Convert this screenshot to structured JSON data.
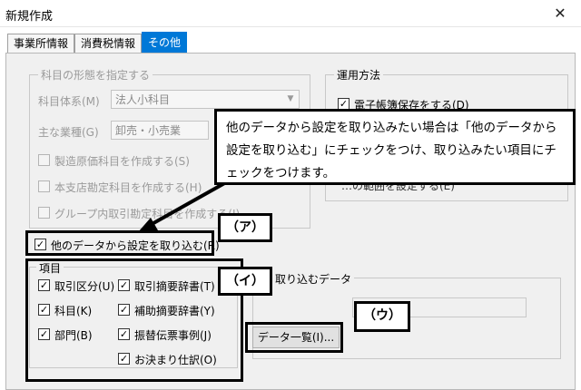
{
  "window": {
    "title": "新規作成",
    "close_glyph": "✕"
  },
  "tabs": [
    {
      "label": "事業所情報"
    },
    {
      "label": "消費税情報"
    },
    {
      "label": "その他"
    }
  ],
  "subject_group": {
    "legend": "科目の形態を指定する",
    "system_label": "科目体系(M)",
    "system_value": "法人小科目",
    "industry_label": "主な業種(G)",
    "industry_value": "卸売・小売業",
    "options": [
      "製造原価科目を作成する(S)",
      "本支店勘定科目を作成する(H)",
      "グループ内取引勘定科目を作成する(I)"
    ]
  },
  "operation_group": {
    "legend": "運用方法",
    "option1": "電子帳簿保存をする(D)",
    "option2_partial": "…の範囲を設定する(E)"
  },
  "import": {
    "main_checkbox": "他のデータから設定を取り込む(R)",
    "items_legend": "項目",
    "items_col1": [
      "取引区分(U)",
      "科目(K)",
      "部門(B)"
    ],
    "items_col2": [
      "取引摘要辞書(T)",
      "補助摘要辞書(Y)",
      "振替伝票事例(J)",
      "お決まり仕訳(O)"
    ],
    "data_legend": "取り込むデータ",
    "data_button": "データ一覧(I)..."
  },
  "callout": {
    "text_line1": "他のデータから設定を取り込みたい場合は「他のデータから",
    "text_line2": "設定を取り込む」にチェックをつけ、取り込みたい項目にチ",
    "text_line3": "ェックをつけます。"
  },
  "badges": {
    "a": "（ア）",
    "i": "（イ）",
    "u": "（ウ）"
  },
  "check_glyph": "✓",
  "dropdown_glyph": "▼"
}
